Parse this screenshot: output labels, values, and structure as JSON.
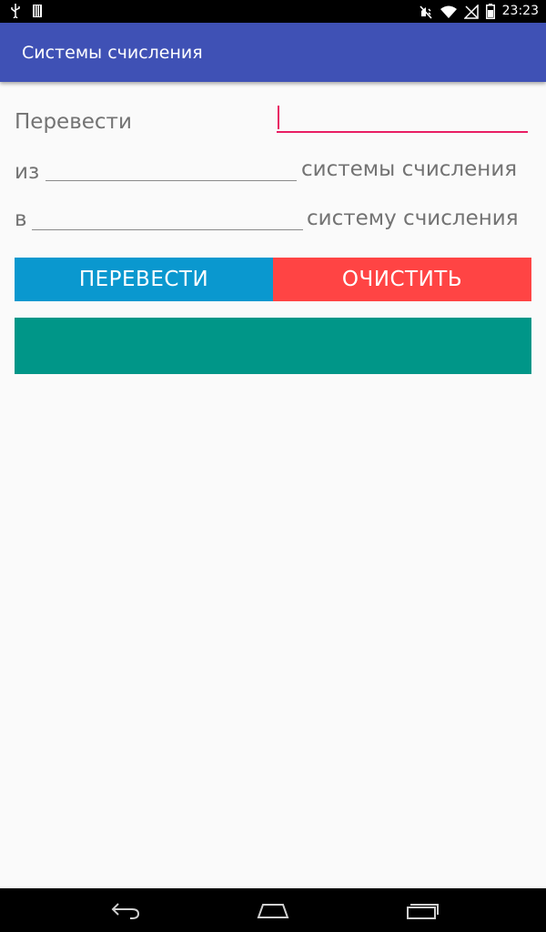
{
  "status_bar": {
    "time": "23:23",
    "icons": [
      "usb-icon",
      "storage-icon",
      "mute-icon",
      "wifi-icon",
      "signal-off-icon",
      "battery-icon"
    ]
  },
  "app_bar": {
    "title": "Системы счисления",
    "background": "#3f51b5"
  },
  "form": {
    "convert_label": "Перевести",
    "number_value": "",
    "from_label": "из",
    "from_value": "",
    "from_suffix": "системы счисления",
    "to_label": "в",
    "to_value": "",
    "to_suffix": "систему счисления"
  },
  "buttons": {
    "convert_label": "ПЕРЕВЕСТИ",
    "convert_color": "#0a98cf",
    "clear_label": "ОЧИСТИТЬ",
    "clear_color": "#ff4444"
  },
  "result": {
    "text": "",
    "color": "#009688"
  },
  "nav_bar": {
    "icons": [
      "back-icon",
      "home-icon",
      "recents-icon"
    ]
  }
}
